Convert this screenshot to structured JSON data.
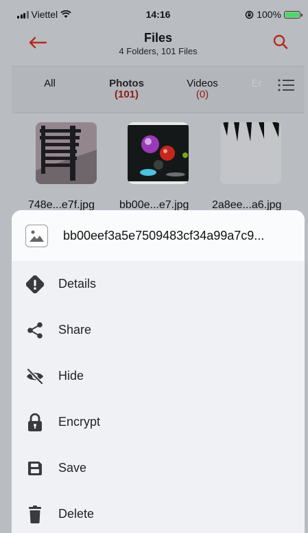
{
  "status_bar": {
    "carrier": "Viettel",
    "time": "14:16",
    "battery": "100%"
  },
  "header": {
    "title": "Files",
    "subtitle": "4 Folders, 101 Files"
  },
  "tabs": [
    {
      "label": "All",
      "count": ""
    },
    {
      "label": "Photos",
      "count": "(101)"
    },
    {
      "label": "Videos",
      "count": "(0)"
    },
    {
      "label": "Er",
      "count": ""
    }
  ],
  "thumbnails": [
    {
      "filename": "748e...e7f.jpg"
    },
    {
      "filename": "bb00e...e7.jpg"
    },
    {
      "filename": "2a8ee...a6.jpg"
    }
  ],
  "sheet": {
    "filename": "bb00eef3a5e7509483cf34a99a7c9...",
    "items": [
      {
        "label": "Details",
        "icon": "info-icon"
      },
      {
        "label": "Share",
        "icon": "share-icon"
      },
      {
        "label": "Hide",
        "icon": "eye-off-icon"
      },
      {
        "label": "Encrypt",
        "icon": "lock-icon"
      },
      {
        "label": "Save",
        "icon": "save-icon"
      },
      {
        "label": "Delete",
        "icon": "trash-icon"
      }
    ]
  },
  "colors": {
    "accent": "#b32a1c",
    "count_red": "#8b1e14",
    "battery_green": "#4cd964"
  }
}
